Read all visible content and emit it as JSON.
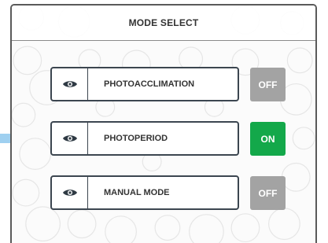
{
  "header": {
    "title": "MODE SELECT"
  },
  "modes": [
    {
      "label": "PHOTOACCLIMATION",
      "state": "OFF"
    },
    {
      "label": "PHOTOPERIOD",
      "state": "ON"
    },
    {
      "label": "MANUAL MODE",
      "state": "OFF"
    }
  ],
  "colors": {
    "on": "#13a84a",
    "off": "#a3a3a3",
    "border": "#3c4650",
    "pointer": "#9fd0f0"
  },
  "icons": {
    "mode_icon": "eye-icon",
    "pointer": "arrow-right-icon"
  },
  "selected_mode": "PHOTOPERIOD"
}
